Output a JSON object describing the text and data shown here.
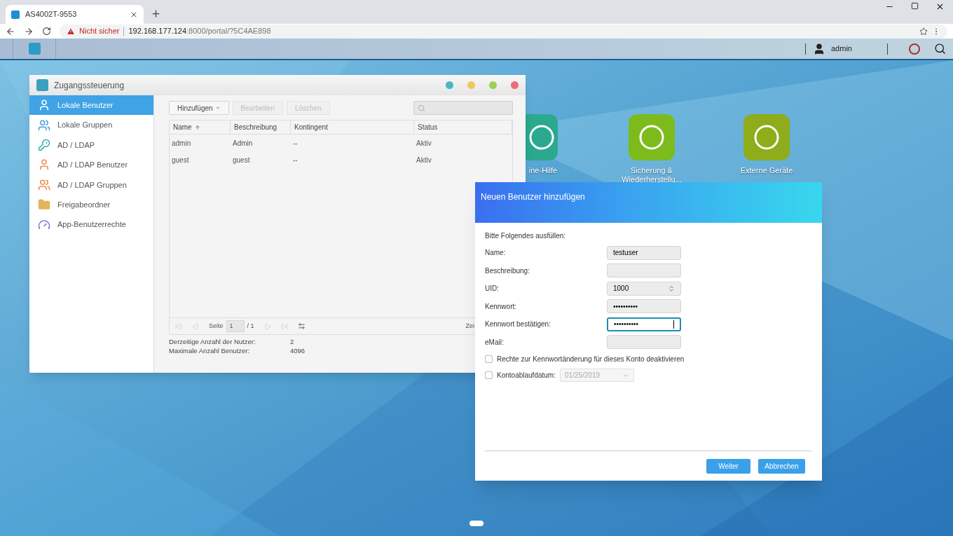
{
  "browser": {
    "tab_title": "AS4002T-9553",
    "security": "Nicht sicher",
    "url_host": "192.168.177.124",
    "url_rest": ":8000/portal/?5C4AE898"
  },
  "taskbar": {
    "user": "admin"
  },
  "desktop_icons": [
    {
      "label": "ine-Hilfe",
      "color": "#2aa98f"
    },
    {
      "label": "Sicherung & Wiederherstellu...",
      "color": "#7dbb1c"
    },
    {
      "label": "Externe Geräte",
      "color": "#8fac1a"
    }
  ],
  "window": {
    "title": "Zugangssteuerung",
    "sidebar": [
      {
        "label": "Lokale Benutzer",
        "selected": true,
        "color": "#3fa3e6"
      },
      {
        "label": "Lokale Gruppen",
        "selected": false,
        "color": "#3fa3e6"
      },
      {
        "label": "AD / LDAP",
        "selected": false,
        "color": "#2fb3a8"
      },
      {
        "label": "AD / LDAP Benutzer",
        "selected": false,
        "color": "#ef8a4a"
      },
      {
        "label": "AD / LDAP Gruppen",
        "selected": false,
        "color": "#ef8a4a"
      },
      {
        "label": "Freigabeordner",
        "selected": false,
        "color": "#e6b35a"
      },
      {
        "label": "App-Benutzerrechte",
        "selected": false,
        "color": "#6a72d0"
      }
    ],
    "toolbar": [
      {
        "label": "Hinzufügen",
        "disabled": false
      },
      {
        "label": "Bearbeiten",
        "disabled": true
      },
      {
        "label": "Löschen",
        "disabled": true
      }
    ],
    "table": {
      "columns": [
        "Name",
        "Beschreibung",
        "Kontingent",
        "Status"
      ],
      "rows": [
        [
          "admin",
          "Admin",
          "--",
          "Aktiv"
        ],
        [
          "guest",
          "guest",
          "--",
          "Aktiv"
        ]
      ]
    },
    "pager": {
      "label": "Seite",
      "page": "1",
      "total": "/ 1",
      "cut": "Zei"
    },
    "stats": [
      {
        "label": "Derzeitige Anzahl der Nutzer:",
        "value": "2"
      },
      {
        "label": "Maximale Anzahl Benutzer:",
        "value": "4096"
      }
    ]
  },
  "dialog": {
    "title": "Neuen Benutzer hinzufügen",
    "intro": "Bitte Folgendes ausfüllen:",
    "fields": [
      {
        "label": "Name:",
        "value": "testuser",
        "kind": "text",
        "focused": false
      },
      {
        "label": "Beschreibung:",
        "kind": "text",
        "focused": false
      },
      {
        "label": "UID:",
        "value": "1000",
        "kind": "number",
        "focused": false
      },
      {
        "label": "Kennwort:",
        "value": "••••••••••",
        "kind": "password",
        "focused": false
      },
      {
        "label": "Kennwort bestätigen:",
        "value": "••••••••••",
        "kind": "password",
        "focused": true
      },
      {
        "label": "eMail:",
        "kind": "text",
        "focused": false
      }
    ],
    "options": [
      {
        "label": "Rechte zur Kennwortänderung für dieses Konto deaktivieren",
        "checked": false
      },
      {
        "label": "Kontoablaufdatum:",
        "checked": false,
        "date": "01/25/2019"
      }
    ],
    "buttons": [
      "Weiter",
      "Abbrechen"
    ]
  }
}
